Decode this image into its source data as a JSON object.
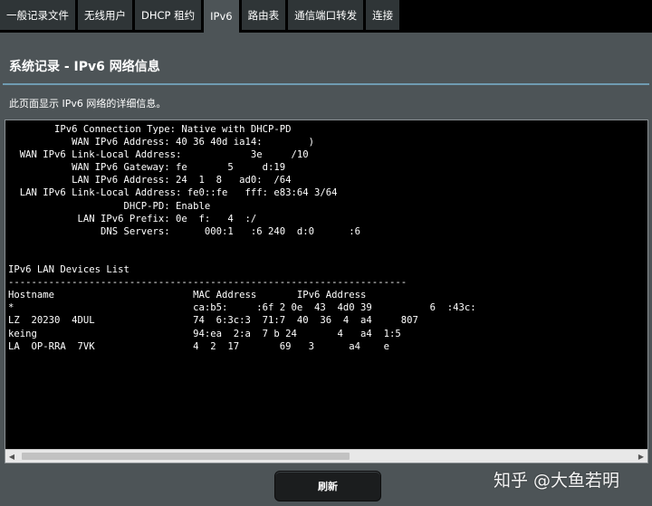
{
  "tabs": [
    {
      "label": "一般记录文件",
      "active": false
    },
    {
      "label": "无线用户",
      "active": false
    },
    {
      "label": "DHCP 租约",
      "active": false
    },
    {
      "label": "IPv6",
      "active": true
    },
    {
      "label": "路由表",
      "active": false
    },
    {
      "label": "通信端口转发",
      "active": false
    },
    {
      "label": "连接",
      "active": false
    }
  ],
  "page": {
    "title": "系统记录 - IPv6 网络信息",
    "description": "此页面显示 IPv6 网络的详细信息。"
  },
  "log_lines": [
    "        IPv6 Connection Type: Native with DHCP-PD",
    "           WAN IPv6 Address: 40 36 40d ia14:        )",
    "  WAN IPv6 Link-Local Address:            3e     /10",
    "           WAN IPv6 Gateway: fe       5     d:19",
    "           LAN IPv6 Address: 24  1  8   ad0:  /64",
    "  LAN IPv6 Link-Local Address: fe0::fe   fff: e83:64 3/64",
    "                    DHCP-PD: Enable",
    "            LAN IPv6 Prefix: 0e  f:   4  :/",
    "                DNS Servers:      000:1   :6 240  d:0      :6",
    "",
    "",
    "IPv6 LAN Devices List",
    "---------------------------------------------------------------------",
    "Hostname                        MAC Address       IPv6 Address",
    "*                               ca:b5:     :6f 2 0e  43  4d0 39          6  :43c:",
    "LZ  20230  4DUL                 74  6:3c:3  71:7  40  36  4  a4     807",
    "keing                           94:ea  2:a  7 b 24       4   a4  1:5",
    "LA  OP-RRA  7VK                 4  2  17       69   3      a4    e"
  ],
  "buttons": {
    "refresh": "刷新"
  },
  "watermark": "知乎 @大鱼若明"
}
